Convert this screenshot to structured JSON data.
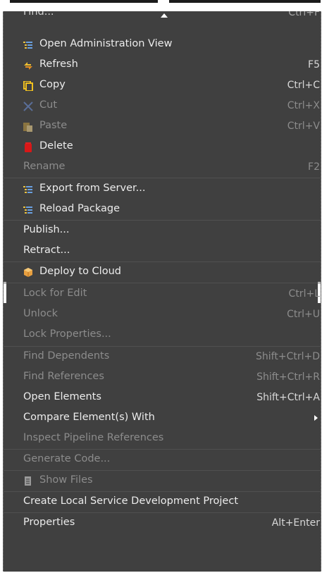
{
  "menu": {
    "partial_item": {
      "label": "Find...",
      "shortcut": "Ctrl+F"
    },
    "items": [
      {
        "label": "Open Administration View",
        "shortcut": "",
        "icon": "admin-view-icon",
        "enabled": true
      },
      {
        "label": "Refresh",
        "shortcut": "F5",
        "icon": "refresh-icon",
        "enabled": true
      },
      {
        "label": "Copy",
        "shortcut": "Ctrl+C",
        "icon": "copy-icon",
        "enabled": true
      },
      {
        "label": "Cut",
        "shortcut": "Ctrl+X",
        "icon": "cut-icon",
        "enabled": false
      },
      {
        "label": "Paste",
        "shortcut": "Ctrl+V",
        "icon": "paste-icon",
        "enabled": false
      },
      {
        "label": "Delete",
        "shortcut": "",
        "icon": "delete-icon",
        "enabled": true
      },
      {
        "label": "Rename",
        "shortcut": "F2",
        "icon": "",
        "enabled": false
      },
      {
        "label": "Export from Server...",
        "shortcut": "",
        "icon": "export-icon",
        "enabled": true
      },
      {
        "label": "Reload Package",
        "shortcut": "",
        "icon": "reload-package-icon",
        "enabled": true
      },
      {
        "label": "Publish...",
        "shortcut": "",
        "icon": "",
        "enabled": true
      },
      {
        "label": "Retract...",
        "shortcut": "",
        "icon": "",
        "enabled": true
      },
      {
        "label": "Deploy to Cloud",
        "shortcut": "",
        "icon": "cloud-deploy-icon",
        "enabled": true
      },
      {
        "label": "Lock for Edit",
        "shortcut": "Ctrl+L",
        "icon": "",
        "enabled": false
      },
      {
        "label": "Unlock",
        "shortcut": "Ctrl+U",
        "icon": "",
        "enabled": false
      },
      {
        "label": "Lock Properties...",
        "shortcut": "",
        "icon": "",
        "enabled": false
      },
      {
        "label": "Find Dependents",
        "shortcut": "Shift+Ctrl+D",
        "icon": "",
        "enabled": false
      },
      {
        "label": "Find References",
        "shortcut": "Shift+Ctrl+R",
        "icon": "",
        "enabled": false
      },
      {
        "label": "Open Elements",
        "shortcut": "Shift+Ctrl+A",
        "icon": "",
        "enabled": true
      },
      {
        "label": "Compare Element(s) With",
        "shortcut": "",
        "icon": "",
        "enabled": true,
        "submenu": true
      },
      {
        "label": "Inspect Pipeline References",
        "shortcut": "",
        "icon": "",
        "enabled": false
      },
      {
        "label": "Generate Code...",
        "shortcut": "",
        "icon": "",
        "enabled": false
      },
      {
        "label": "Show Files",
        "shortcut": "",
        "icon": "show-files-icon",
        "enabled": false
      },
      {
        "label": "Create Local Service Development Project",
        "shortcut": "",
        "icon": "",
        "enabled": true
      },
      {
        "label": "Properties",
        "shortcut": "Alt+Enter",
        "icon": "",
        "enabled": true
      }
    ]
  }
}
